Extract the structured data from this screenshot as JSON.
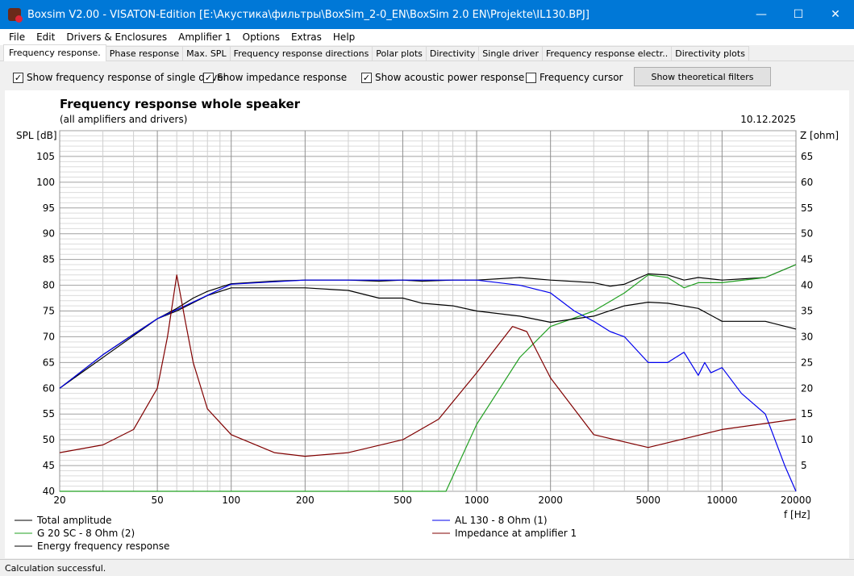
{
  "window": {
    "title": "Boxsim V2.00 - VISATON-Edition [E:\\Акустика\\фильтры\\BoxSim_2-0_EN\\BoxSim 2.0 EN\\Projekte\\IL130.BPJ]"
  },
  "menu": [
    "File",
    "Edit",
    "Drivers & Enclosures",
    "Amplifier 1",
    "Options",
    "Extras",
    "Help"
  ],
  "tabs": [
    "Frequency response.",
    "Phase response",
    "Max. SPL",
    "Frequency response directions",
    "Polar plots",
    "Directivity",
    "Single driver",
    "Frequency response electr..",
    "Directivity plots"
  ],
  "options": [
    {
      "label": "Show frequency response of single driver",
      "checked": true
    },
    {
      "label": "Show impedance response",
      "checked": true
    },
    {
      "label": "Show acoustic power response",
      "checked": true
    },
    {
      "label": "Frequency cursor",
      "checked": false
    }
  ],
  "theoretical_button": "Show theoretical filters",
  "status": "Calculation successful.",
  "chart_data": {
    "type": "line",
    "title": "Frequency response whole speaker",
    "subtitle": "(all amplifiers and drivers)",
    "date": "10.12.2025",
    "ylabel": "SPL [dB]",
    "y2label": "Z [ohm]",
    "xlabel": "f [Hz]",
    "xscale": "log",
    "xlim": [
      20,
      20000
    ],
    "ylim": [
      40,
      110
    ],
    "y2lim": [
      0,
      70
    ],
    "xticks": [
      20,
      50,
      100,
      200,
      500,
      1000,
      2000,
      5000,
      10000,
      20000
    ],
    "yticks": [
      40,
      45,
      50,
      55,
      60,
      65,
      70,
      75,
      80,
      85,
      90,
      95,
      100,
      105
    ],
    "y2ticks": [
      5,
      10,
      15,
      20,
      25,
      30,
      35,
      40,
      45,
      50,
      55,
      60,
      65
    ],
    "series": [
      {
        "name": "Total amplitude",
        "color": "#000000",
        "axis": "left",
        "points": [
          [
            20,
            60
          ],
          [
            30,
            66.5
          ],
          [
            40,
            70.5
          ],
          [
            50,
            73.5
          ],
          [
            60,
            75.5
          ],
          [
            70,
            77.5
          ],
          [
            80,
            78.8
          ],
          [
            100,
            80.3
          ],
          [
            150,
            80.8
          ],
          [
            200,
            81
          ],
          [
            300,
            81
          ],
          [
            400,
            80.8
          ],
          [
            500,
            81
          ],
          [
            600,
            80.8
          ],
          [
            800,
            81
          ],
          [
            1000,
            81
          ],
          [
            1500,
            81.5
          ],
          [
            2000,
            81
          ],
          [
            3000,
            80.5
          ],
          [
            3500,
            79.8
          ],
          [
            4000,
            80.2
          ],
          [
            5000,
            82.2
          ],
          [
            6000,
            82
          ],
          [
            7000,
            81
          ],
          [
            8000,
            81.5
          ],
          [
            10000,
            81
          ],
          [
            15000,
            81.5
          ],
          [
            20000,
            84
          ]
        ]
      },
      {
        "name": "G 20 SC - 8 Ohm (2)",
        "color": "#22a022",
        "axis": "left",
        "points": [
          [
            20,
            40
          ],
          [
            750,
            40
          ],
          [
            1000,
            53
          ],
          [
            1500,
            66
          ],
          [
            2000,
            72
          ],
          [
            3000,
            75
          ],
          [
            4000,
            78.5
          ],
          [
            5000,
            82
          ],
          [
            6000,
            81.5
          ],
          [
            7000,
            79.5
          ],
          [
            8000,
            80.5
          ],
          [
            10000,
            80.5
          ],
          [
            15000,
            81.5
          ],
          [
            20000,
            84
          ]
        ]
      },
      {
        "name": "Energy frequency response",
        "color": "#000000",
        "axis": "left",
        "points": [
          [
            20,
            60
          ],
          [
            50,
            73.5
          ],
          [
            60,
            75
          ],
          [
            80,
            78
          ],
          [
            100,
            79.5
          ],
          [
            200,
            79.5
          ],
          [
            300,
            79
          ],
          [
            400,
            77.5
          ],
          [
            500,
            77.5
          ],
          [
            600,
            76.5
          ],
          [
            800,
            76
          ],
          [
            1000,
            75
          ],
          [
            1500,
            74
          ],
          [
            2000,
            72.8
          ],
          [
            3000,
            74
          ],
          [
            4000,
            76
          ],
          [
            5000,
            76.7
          ],
          [
            6000,
            76.5
          ],
          [
            8000,
            75.5
          ],
          [
            10000,
            73
          ],
          [
            15000,
            73
          ],
          [
            20000,
            71.5
          ]
        ]
      },
      {
        "name": "AL 130 - 8 Ohm (1)",
        "color": "#0000ee",
        "axis": "left",
        "points": [
          [
            20,
            60
          ],
          [
            30,
            66.5
          ],
          [
            50,
            73.5
          ],
          [
            100,
            80.2
          ],
          [
            200,
            81
          ],
          [
            500,
            81
          ],
          [
            1000,
            81
          ],
          [
            1500,
            80
          ],
          [
            2000,
            78.5
          ],
          [
            2500,
            75
          ],
          [
            3000,
            73
          ],
          [
            3500,
            71
          ],
          [
            4000,
            70
          ],
          [
            5000,
            65
          ],
          [
            6000,
            65
          ],
          [
            7000,
            67
          ],
          [
            8000,
            62.5
          ],
          [
            8500,
            65
          ],
          [
            9000,
            63
          ],
          [
            10000,
            64
          ],
          [
            12000,
            59
          ],
          [
            15000,
            55
          ],
          [
            18000,
            45
          ],
          [
            20000,
            40
          ]
        ]
      },
      {
        "name": "Impedance at amplifier 1",
        "color": "#800000",
        "axis": "right",
        "points": [
          [
            20,
            7.5
          ],
          [
            30,
            9
          ],
          [
            40,
            12
          ],
          [
            50,
            20
          ],
          [
            55,
            30
          ],
          [
            60,
            42
          ],
          [
            65,
            33
          ],
          [
            70,
            25
          ],
          [
            80,
            16
          ],
          [
            100,
            11
          ],
          [
            150,
            7.5
          ],
          [
            200,
            6.8
          ],
          [
            300,
            7.5
          ],
          [
            500,
            10
          ],
          [
            700,
            14
          ],
          [
            1000,
            23
          ],
          [
            1400,
            32
          ],
          [
            1600,
            31
          ],
          [
            2000,
            22
          ],
          [
            3000,
            11
          ],
          [
            5000,
            8.5
          ],
          [
            10000,
            12
          ],
          [
            20000,
            14
          ]
        ]
      }
    ]
  }
}
